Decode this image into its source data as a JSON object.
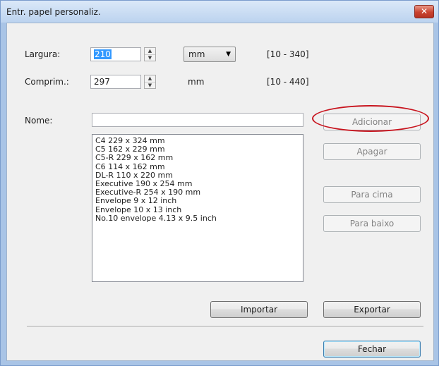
{
  "window": {
    "title": "Entr. papel personaliz.",
    "close_label": "✕"
  },
  "form": {
    "width_label": "Largura:",
    "width_value": "210",
    "unit_dropdown": "mm",
    "width_range": "[10 - 340]",
    "length_label": "Comprim.:",
    "length_value": "297",
    "length_unit": "mm",
    "length_range": "[10 - 440]",
    "name_label": "Nome:",
    "name_value": ""
  },
  "paper_list": [
    "C4 229 x 324 mm",
    "C5 162 x 229 mm",
    "C5-R 229 x 162 mm",
    "C6 114 x 162 mm",
    "DL-R 110 x 220 mm",
    "Executive 190 x 254 mm",
    "Executive-R 254 x 190 mm",
    "Envelope 9 x 12 inch",
    "Envelope 10 x 13 inch",
    "No.10 envelope 4.13 x 9.5 inch"
  ],
  "buttons": {
    "add": "Adicionar",
    "delete": "Apagar",
    "move_up": "Para cima",
    "move_down": "Para baixo",
    "import": "Importar",
    "export": "Exportar",
    "close": "Fechar"
  },
  "colors": {
    "highlight_ellipse": "#c8141e",
    "title_bar": "#dbe8f8",
    "close_button": "#c9422f"
  }
}
